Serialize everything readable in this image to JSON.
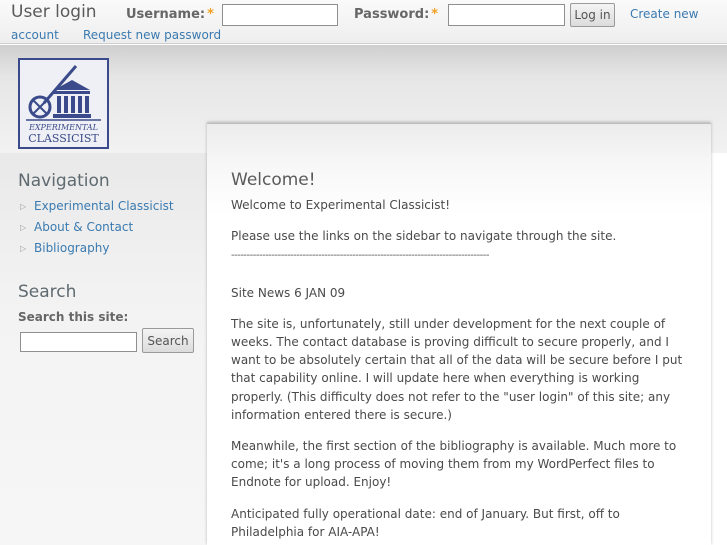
{
  "login": {
    "title": "User login",
    "username_label": "Username:",
    "password_label": "Password:",
    "required_mark": "*",
    "username_value": "",
    "password_value": "",
    "login_button": "Log in",
    "create_account_part1": "Create new",
    "create_account_part2": "account",
    "request_password": "Request new password"
  },
  "logo": {
    "line1": "EXPERIMENTAL",
    "line2": "CLASSICIST"
  },
  "sidebar": {
    "nav_heading": "Navigation",
    "nav_items": [
      {
        "label": "Experimental Classicist"
      },
      {
        "label": "About & Contact"
      },
      {
        "label": "Bibliography"
      }
    ],
    "search_heading": "Search",
    "search_label": "Search this site:",
    "search_value": "",
    "search_button": "Search"
  },
  "content": {
    "title": "Welcome!",
    "p1": "Welcome to Experimental Classicist!",
    "p2": "Please use the links on the sidebar to navigate through the site.",
    "divider": "-----------------------------------------------------------------------------------",
    "p3": "Site News 6 JAN 09",
    "p4": "The site is, unfortunately, still under development for the next couple of weeks. The contact database is proving difficult to secure properly, and I want to be absolutely certain that all of the data will be secure before I put that capability online. I will update here when everything is working properly. (This difficulty does not refer to the \"user login\" of this site; any information entered there is secure.)",
    "p5": "Meanwhile, the first section of the bibliography is available. Much more to come; it's a long process of moving them from my WordPerfect files to Endnote for upload. Enjoy!",
    "p6": "Anticipated fully operational date: end of January. But first, off to Philadelphia for AIA-APA!"
  },
  "colors": {
    "link": "#3a7ab0",
    "required": "#f0a020",
    "logo_border": "#3a4a8a"
  }
}
